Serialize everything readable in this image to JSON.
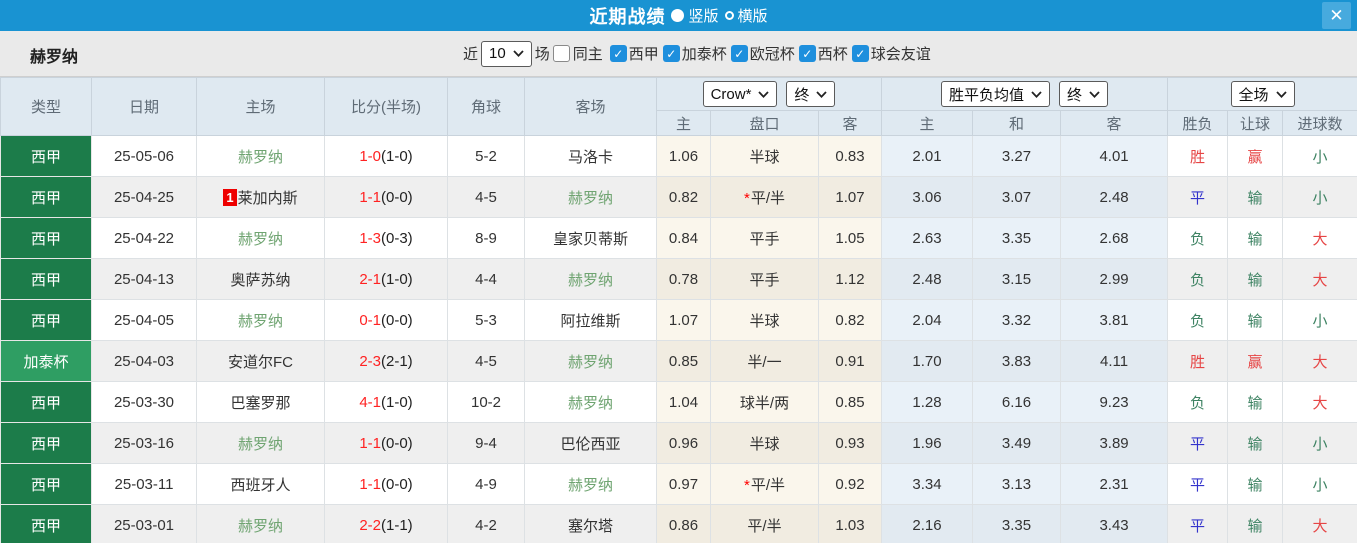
{
  "colors": {
    "topbar_blue": "#1993d2",
    "close_button_blue": "#47aade",
    "checkbox_blue": "#1e8fdd",
    "league_green": "#1c7c4a",
    "cup_green": "#2f9e63",
    "team_self_green": "#6fa471",
    "score_red": "#ff2222",
    "result_red": "#e64545",
    "result_blue": "#3333cc",
    "result_green": "#3e8363",
    "header_bg": "#dfe9f1",
    "row_alt_bg": "#efefef",
    "crow_col_bg": "#faf6ec",
    "avg_col_bg": "#e9f1f8"
  },
  "icons": {
    "check": "✓",
    "close": "✕"
  },
  "titlebar": {
    "title": "近期战绩",
    "radio_vertical": "竖版",
    "radio_horizontal": "横版"
  },
  "filterbar": {
    "team": "赫罗纳",
    "near_label": "近",
    "near_value": "10",
    "matches_label": "场",
    "same_home_label": "同主",
    "leagues": [
      "西甲",
      "加泰杯",
      "欧冠杯",
      "西杯",
      "球会友谊"
    ]
  },
  "table": {
    "main_headers": [
      "类型",
      "日期",
      "主场",
      "比分(半场)",
      "角球",
      "客场"
    ],
    "selects": {
      "odds_company": "Crow*",
      "odds_time": "终",
      "avg_label": "胜平负均值",
      "avg_time": "终",
      "scope": "全场"
    },
    "sub_headers": [
      "主",
      "盘口",
      "客",
      "主",
      "和",
      "客",
      "胜负",
      "让球",
      "进球数"
    ],
    "rows": [
      {
        "type": "西甲",
        "cup": false,
        "date": "25-05-06",
        "home": "赫罗纳",
        "home_self": true,
        "home_badge": "",
        "score": "1-0",
        "half": "(1-0)",
        "corner": "5-2",
        "away": "马洛卡",
        "away_self": false,
        "odds_home": "1.06",
        "handicap": "半球",
        "handicap_star": false,
        "odds_away": "0.83",
        "avg_win": "2.01",
        "avg_draw": "3.27",
        "avg_lose": "4.01",
        "result": "胜",
        "result_color": "red",
        "handicap_result": "赢",
        "handicap_result_color": "red",
        "goals_result": "小",
        "goals_result_color": "green"
      },
      {
        "type": "西甲",
        "cup": false,
        "date": "25-04-25",
        "home": "莱加内斯",
        "home_self": false,
        "home_badge": "1",
        "score": "1-1",
        "half": "(0-0)",
        "corner": "4-5",
        "away": "赫罗纳",
        "away_self": true,
        "odds_home": "0.82",
        "handicap": "平/半",
        "handicap_star": true,
        "odds_away": "1.07",
        "avg_win": "3.06",
        "avg_draw": "3.07",
        "avg_lose": "2.48",
        "result": "平",
        "result_color": "blue",
        "handicap_result": "输",
        "handicap_result_color": "green",
        "goals_result": "小",
        "goals_result_color": "green"
      },
      {
        "type": "西甲",
        "cup": false,
        "date": "25-04-22",
        "home": "赫罗纳",
        "home_self": true,
        "home_badge": "",
        "score": "1-3",
        "half": "(0-3)",
        "corner": "8-9",
        "away": "皇家贝蒂斯",
        "away_self": false,
        "odds_home": "0.84",
        "handicap": "平手",
        "handicap_star": false,
        "odds_away": "1.05",
        "avg_win": "2.63",
        "avg_draw": "3.35",
        "avg_lose": "2.68",
        "result": "负",
        "result_color": "green",
        "handicap_result": "输",
        "handicap_result_color": "green",
        "goals_result": "大",
        "goals_result_color": "red"
      },
      {
        "type": "西甲",
        "cup": false,
        "date": "25-04-13",
        "home": "奥萨苏纳",
        "home_self": false,
        "home_badge": "",
        "score": "2-1",
        "half": "(1-0)",
        "corner": "4-4",
        "away": "赫罗纳",
        "away_self": true,
        "odds_home": "0.78",
        "handicap": "平手",
        "handicap_star": false,
        "odds_away": "1.12",
        "avg_win": "2.48",
        "avg_draw": "3.15",
        "avg_lose": "2.99",
        "result": "负",
        "result_color": "green",
        "handicap_result": "输",
        "handicap_result_color": "green",
        "goals_result": "大",
        "goals_result_color": "red"
      },
      {
        "type": "西甲",
        "cup": false,
        "date": "25-04-05",
        "home": "赫罗纳",
        "home_self": true,
        "home_badge": "",
        "score": "0-1",
        "half": "(0-0)",
        "corner": "5-3",
        "away": "阿拉维斯",
        "away_self": false,
        "odds_home": "1.07",
        "handicap": "半球",
        "handicap_star": false,
        "odds_away": "0.82",
        "avg_win": "2.04",
        "avg_draw": "3.32",
        "avg_lose": "3.81",
        "result": "负",
        "result_color": "green",
        "handicap_result": "输",
        "handicap_result_color": "green",
        "goals_result": "小",
        "goals_result_color": "green"
      },
      {
        "type": "加泰杯",
        "cup": true,
        "date": "25-04-03",
        "home": "安道尔FC",
        "home_self": false,
        "home_badge": "",
        "score": "2-3",
        "half": "(2-1)",
        "corner": "4-5",
        "away": "赫罗纳",
        "away_self": true,
        "odds_home": "0.85",
        "handicap": "半/一",
        "handicap_star": false,
        "odds_away": "0.91",
        "avg_win": "1.70",
        "avg_draw": "3.83",
        "avg_lose": "4.11",
        "result": "胜",
        "result_color": "red",
        "handicap_result": "赢",
        "handicap_result_color": "red",
        "goals_result": "大",
        "goals_result_color": "red"
      },
      {
        "type": "西甲",
        "cup": false,
        "date": "25-03-30",
        "home": "巴塞罗那",
        "home_self": false,
        "home_badge": "",
        "score": "4-1",
        "half": "(1-0)",
        "corner": "10-2",
        "away": "赫罗纳",
        "away_self": true,
        "odds_home": "1.04",
        "handicap": "球半/两",
        "handicap_star": false,
        "odds_away": "0.85",
        "avg_win": "1.28",
        "avg_draw": "6.16",
        "avg_lose": "9.23",
        "result": "负",
        "result_color": "green",
        "handicap_result": "输",
        "handicap_result_color": "green",
        "goals_result": "大",
        "goals_result_color": "red"
      },
      {
        "type": "西甲",
        "cup": false,
        "date": "25-03-16",
        "home": "赫罗纳",
        "home_self": true,
        "home_badge": "",
        "score": "1-1",
        "half": "(0-0)",
        "corner": "9-4",
        "away": "巴伦西亚",
        "away_self": false,
        "odds_home": "0.96",
        "handicap": "半球",
        "handicap_star": false,
        "odds_away": "0.93",
        "avg_win": "1.96",
        "avg_draw": "3.49",
        "avg_lose": "3.89",
        "result": "平",
        "result_color": "blue",
        "handicap_result": "输",
        "handicap_result_color": "green",
        "goals_result": "小",
        "goals_result_color": "green"
      },
      {
        "type": "西甲",
        "cup": false,
        "date": "25-03-11",
        "home": "西班牙人",
        "home_self": false,
        "home_badge": "",
        "score": "1-1",
        "half": "(0-0)",
        "corner": "4-9",
        "away": "赫罗纳",
        "away_self": true,
        "odds_home": "0.97",
        "handicap": "平/半",
        "handicap_star": true,
        "odds_away": "0.92",
        "avg_win": "3.34",
        "avg_draw": "3.13",
        "avg_lose": "2.31",
        "result": "平",
        "result_color": "blue",
        "handicap_result": "输",
        "handicap_result_color": "green",
        "goals_result": "小",
        "goals_result_color": "green"
      },
      {
        "type": "西甲",
        "cup": false,
        "date": "25-03-01",
        "home": "赫罗纳",
        "home_self": true,
        "home_badge": "",
        "score": "2-2",
        "half": "(1-1)",
        "corner": "4-2",
        "away": "塞尔塔",
        "away_self": false,
        "odds_home": "0.86",
        "handicap": "平/半",
        "handicap_star": false,
        "odds_away": "1.03",
        "avg_win": "2.16",
        "avg_draw": "3.35",
        "avg_lose": "3.43",
        "result": "平",
        "result_color": "blue",
        "handicap_result": "输",
        "handicap_result_color": "green",
        "goals_result": "大",
        "goals_result_color": "red"
      }
    ]
  }
}
